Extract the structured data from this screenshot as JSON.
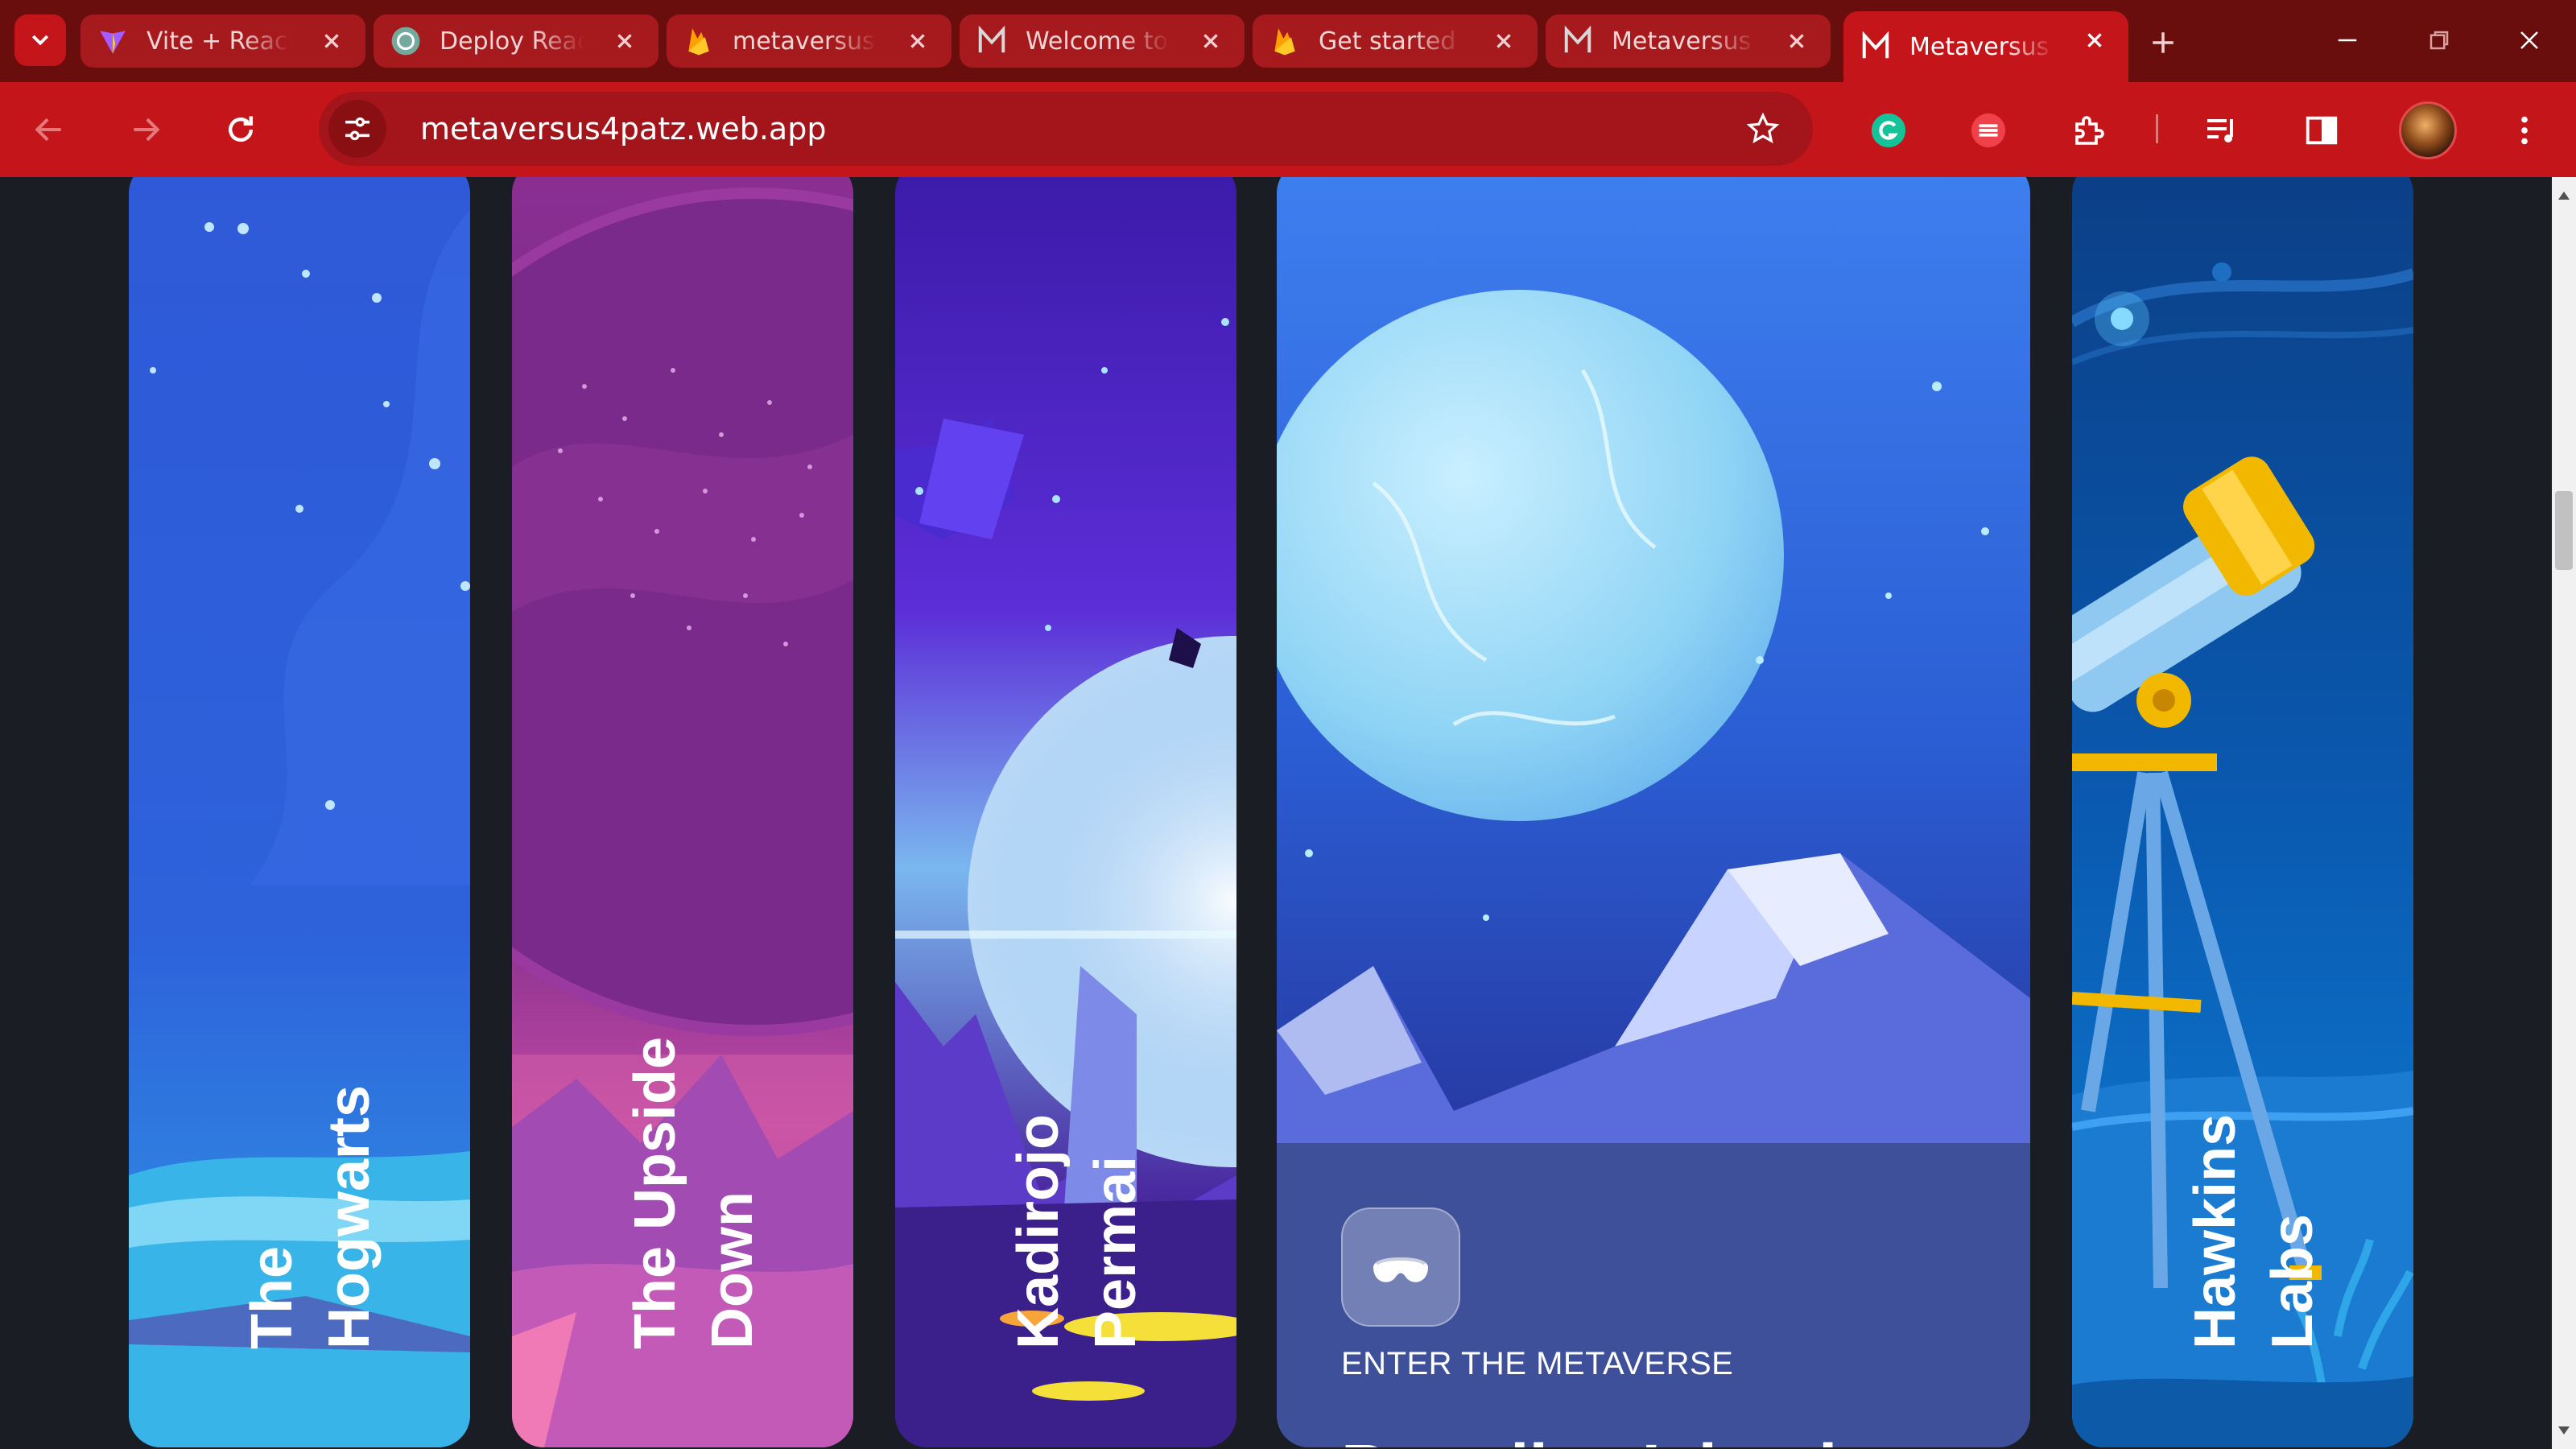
{
  "browser": {
    "tabs": [
      {
        "title": "Vite + React",
        "favicon": "vite-icon",
        "active": false
      },
      {
        "title": "Deploy React",
        "favicon": "chatgpt-icon",
        "active": false
      },
      {
        "title": "metaversus",
        "favicon": "firebase-icon",
        "active": false
      },
      {
        "title": "Welcome to",
        "favicon": "m-logo-icon",
        "active": false
      },
      {
        "title": "Get started",
        "favicon": "firebase-icon",
        "active": false
      },
      {
        "title": "Metaversus",
        "favicon": "m-logo-icon",
        "active": false
      },
      {
        "title": "Metaversus",
        "favicon": "m-logo-icon",
        "active": true
      }
    ],
    "url": "metaversus4patz.web.app",
    "colors": {
      "tabbar": "#6a0d0d",
      "toolbar": "#c4161a",
      "omnibox": "#a3151a"
    }
  },
  "worlds": [
    {
      "id": "hogwarts",
      "lines": [
        "The",
        "Hogwarts"
      ]
    },
    {
      "id": "upside",
      "lines": [
        "The Upside",
        "Down"
      ]
    },
    {
      "id": "kadirojo",
      "lines": [
        "Kadirojo",
        "Permai"
      ]
    },
    {
      "id": "hawkins",
      "lines": [
        "Hawkins",
        "Labs"
      ]
    }
  ],
  "featured": {
    "title": "Paradise Island",
    "subtitle": "ENTER THE METAVERSE",
    "icon": "vr-headset-icon"
  },
  "scroll": {
    "position": 0.25
  }
}
